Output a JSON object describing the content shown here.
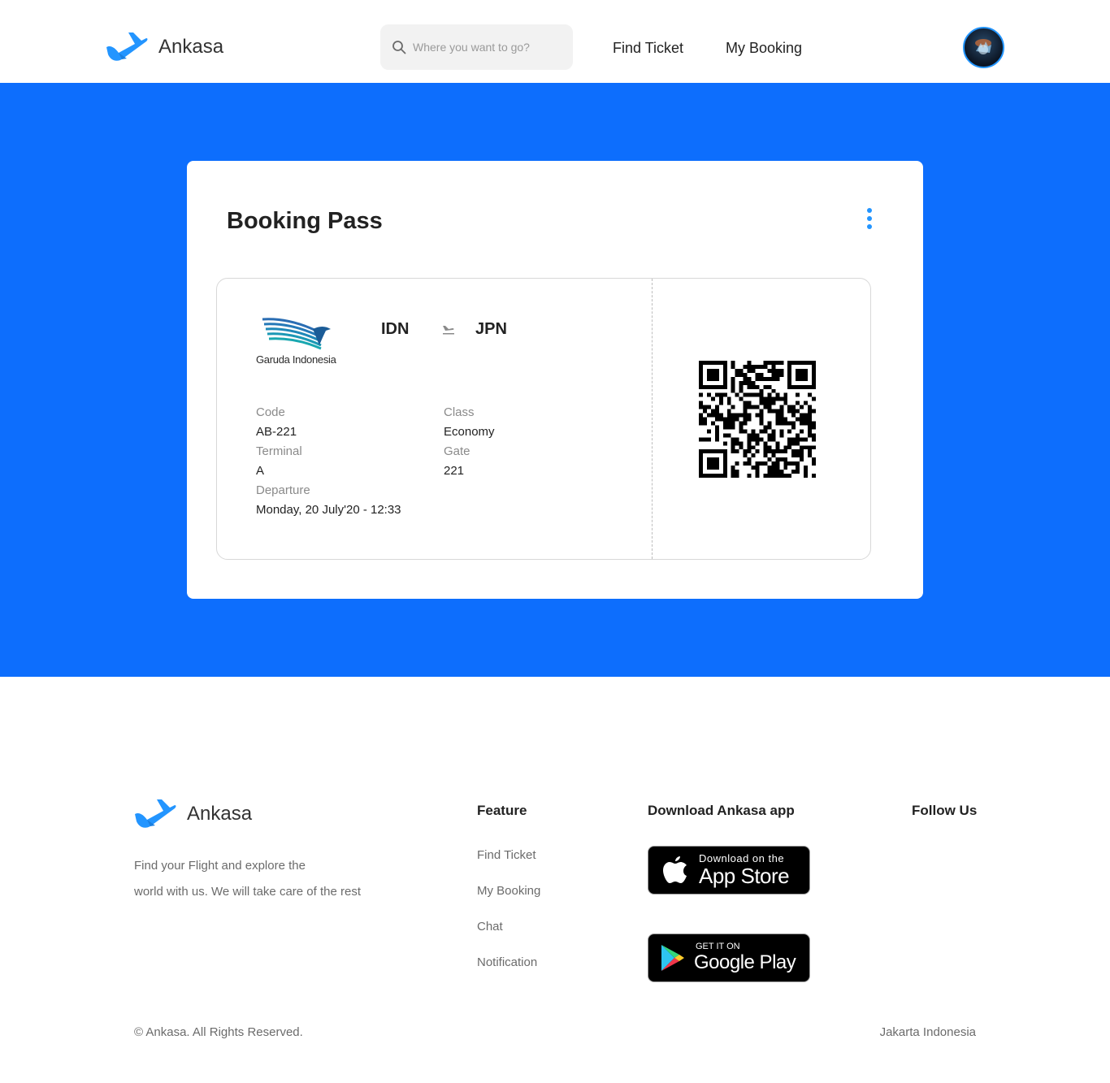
{
  "header": {
    "brand": "Ankasa",
    "search_placeholder": "Where you want to go?",
    "nav": [
      "Find Ticket",
      "My Booking"
    ]
  },
  "booking": {
    "title": "Booking Pass",
    "airline": "Garuda Indonesia",
    "from": "IDN",
    "to": "JPN",
    "fields": {
      "code_label": "Code",
      "code": "AB-221",
      "class_label": "Class",
      "class": "Economy",
      "terminal_label": "Terminal",
      "terminal": "A",
      "gate_label": "Gate",
      "gate": "221",
      "departure_label": "Departure",
      "departure": "Monday, 20 July'20 - 12:33"
    }
  },
  "footer": {
    "brand": "Ankasa",
    "description_line1": "Find your Flight and explore the",
    "description_line2": "world with us. We will take care of the rest",
    "feature_heading": "Feature",
    "feature_links": [
      "Find Ticket",
      "My Booking",
      "Chat",
      "Notification"
    ],
    "download_heading": "Download Ankasa app",
    "app_store_small": "Download on the",
    "app_store_big": "App Store",
    "google_play_small": "GET IT ON",
    "google_play_big": "Google Play",
    "follow_heading": "Follow Us",
    "copyright": "© Ankasa. All Rights Reserved.",
    "location": "Jakarta Indonesia"
  },
  "colors": {
    "primary": "#0d6efd",
    "accent": "#2395ff"
  },
  "icons": [
    "plane-logo-icon",
    "search-icon",
    "more-vertical-icon",
    "plane-route-icon",
    "qr-code",
    "apple-icon",
    "google-play-icon"
  ]
}
